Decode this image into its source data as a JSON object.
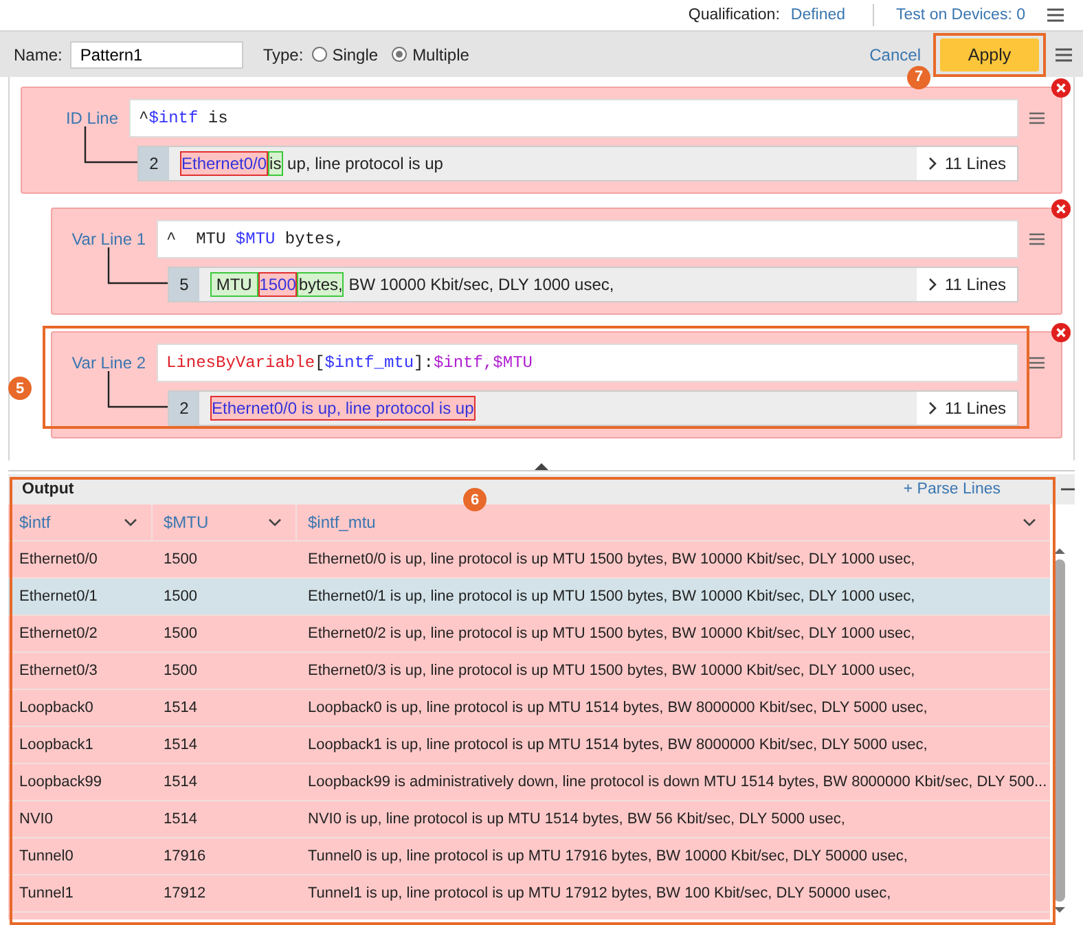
{
  "top_bar": {
    "qualification_label": "Qualification:",
    "qualification_value": "Defined",
    "test_link": "Test on Devices: 0"
  },
  "toolbar": {
    "name_label": "Name:",
    "name_value": "Pattern1",
    "type_label": "Type:",
    "type_options": [
      {
        "label": "Single",
        "selected": false
      },
      {
        "label": "Multiple",
        "selected": true
      }
    ],
    "cancel": "Cancel",
    "apply": "Apply",
    "apply_callout": "7"
  },
  "lines": [
    {
      "label": "ID Line",
      "indented": false,
      "highlighted": false,
      "pattern": [
        {
          "kind": "plain",
          "text": "^"
        },
        {
          "kind": "variable",
          "text": "$intf"
        },
        {
          "kind": "plain",
          "text": " is"
        }
      ],
      "sample_number": "2",
      "sample": [
        {
          "kind": "var",
          "text": "Ethernet0/0"
        },
        {
          "kind": "literal",
          "text": "is"
        },
        {
          "kind": "plain",
          "text": " up, line protocol is up"
        }
      ],
      "more": "11 Lines"
    },
    {
      "label": "Var Line 1",
      "indented": true,
      "highlighted": false,
      "pattern": [
        {
          "kind": "plain",
          "text": "^  MTU "
        },
        {
          "kind": "variable",
          "text": "$MTU"
        },
        {
          "kind": "plain",
          "text": " bytes,"
        }
      ],
      "sample_number": "5",
      "sample": [
        {
          "kind": "literal",
          "text": " MTU "
        },
        {
          "kind": "var",
          "text": "1500"
        },
        {
          "kind": "literal",
          "text": "bytes,"
        },
        {
          "kind": "plain",
          "text": " BW 10000 Kbit/sec, DLY 1000 usec,"
        }
      ],
      "more": "11 Lines"
    },
    {
      "label": "Var Line 2",
      "indented": true,
      "highlighted": true,
      "callout": "5",
      "pattern": [
        {
          "kind": "function",
          "text": "LinesByVariable"
        },
        {
          "kind": "plain",
          "text": "["
        },
        {
          "kind": "variable",
          "text": "$intf_mtu"
        },
        {
          "kind": "plain",
          "text": "]:"
        },
        {
          "kind": "reference",
          "text": "$intf,$MTU"
        }
      ],
      "sample_number": "2",
      "sample": [
        {
          "kind": "var",
          "text": "Ethernet0/0 is up, line protocol is up"
        }
      ],
      "more": "11 Lines"
    }
  ],
  "output": {
    "title": "Output",
    "parse_link": "+ Parse Lines",
    "callout": "6",
    "columns": [
      "$intf",
      "$MTU",
      "$intf_mtu"
    ],
    "rows": [
      {
        "cells": [
          "Ethernet0/0",
          "1500",
          "Ethernet0/0 is up, line protocol is up MTU 1500 bytes, BW 10000 Kbit/sec, DLY 1000 usec,"
        ],
        "selected": false
      },
      {
        "cells": [
          "Ethernet0/1",
          "1500",
          "Ethernet0/1 is up, line protocol is up MTU 1500 bytes, BW 10000 Kbit/sec, DLY 1000 usec,"
        ],
        "selected": true
      },
      {
        "cells": [
          "Ethernet0/2",
          "1500",
          "Ethernet0/2 is up, line protocol is up MTU 1500 bytes, BW 10000 Kbit/sec, DLY 1000 usec,"
        ],
        "selected": false
      },
      {
        "cells": [
          "Ethernet0/3",
          "1500",
          "Ethernet0/3 is up, line protocol is up MTU 1500 bytes, BW 10000 Kbit/sec, DLY 1000 usec,"
        ],
        "selected": false
      },
      {
        "cells": [
          "Loopback0",
          "1514",
          "Loopback0 is up, line protocol is up MTU 1514 bytes, BW 8000000 Kbit/sec, DLY 5000 usec,"
        ],
        "selected": false
      },
      {
        "cells": [
          "Loopback1",
          "1514",
          "Loopback1 is up, line protocol is up MTU 1514 bytes, BW 8000000 Kbit/sec, DLY 5000 usec,"
        ],
        "selected": false
      },
      {
        "cells": [
          "Loopback99",
          "1514",
          "Loopback99 is administratively down, line protocol is down MTU 1514 bytes, BW 8000000 Kbit/sec, DLY 500..."
        ],
        "selected": false
      },
      {
        "cells": [
          "NVI0",
          "1514",
          "NVI0 is up, line protocol is up MTU 1514 bytes, BW 56 Kbit/sec, DLY 5000 usec,"
        ],
        "selected": false
      },
      {
        "cells": [
          "Tunnel0",
          "17916",
          "Tunnel0 is up, line protocol is up MTU 17916 bytes, BW 10000 Kbit/sec, DLY 50000 usec,"
        ],
        "selected": false
      },
      {
        "cells": [
          "Tunnel1",
          "17912",
          "Tunnel1 is up, line protocol is up MTU 17912 bytes, BW 100 Kbit/sec, DLY 50000 usec,"
        ],
        "selected": false
      }
    ]
  }
}
